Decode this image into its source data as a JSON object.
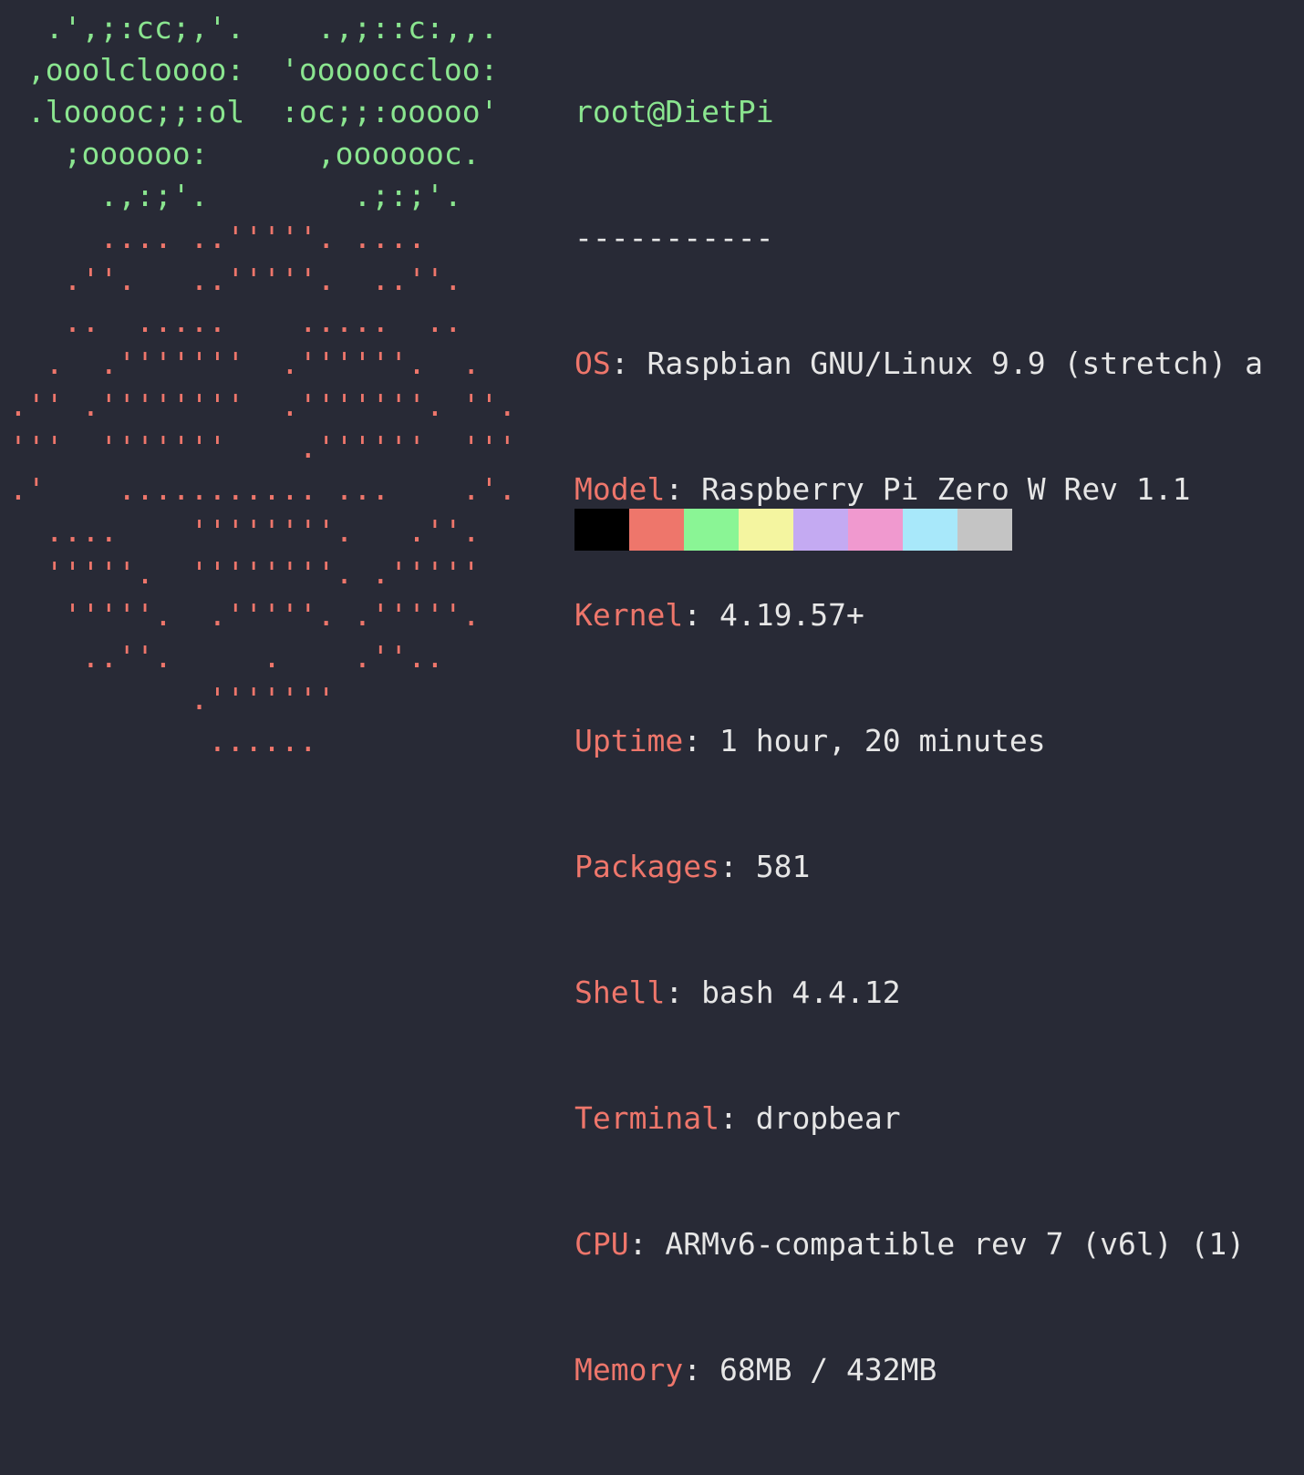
{
  "logo": {
    "green_lines": [
      "  .',;:cc;,'.    .,;::c:,,.",
      " ,ooolcloooo:  'oooooccloo:",
      " .looooc;;:ol  :oc;;:ooooo'",
      "   ;oooooo:      ,ooooooc.",
      "     .,:;'.        .;:;'."
    ],
    "red_lines": [
      "     .... ..'''''. ....",
      "   .''.   ..'''''.  ..''.",
      "   ..  .....    .....  ..",
      "  .  .'''''''  .''''''.  .",
      ".'' .''''''''  .'''''''. ''.",
      "'''  '''''''    .''''''  '''",
      ".'    ........... ...    .'.",
      "  ....    ''''''''.   .''.",
      "  '''''.  ''''''''. .'''''",
      "   '''''.  .'''''. .'''''.",
      "    ..''.     .    .''..",
      "          .'''''''",
      "           ......"
    ]
  },
  "info": {
    "user": "root",
    "at": "@",
    "host": "DietPi",
    "separator": "-----------",
    "fields": [
      {
        "key": "OS",
        "value": "Raspbian GNU/Linux 9.9 (stretch) a"
      },
      {
        "key": "Model",
        "value": "Raspberry Pi Zero W Rev 1.1"
      },
      {
        "key": "Kernel",
        "value": "4.19.57+"
      },
      {
        "key": "Uptime",
        "value": "1 hour, 20 minutes"
      },
      {
        "key": "Packages",
        "value": "581"
      },
      {
        "key": "Shell",
        "value": "bash 4.4.12"
      },
      {
        "key": "Terminal",
        "value": "dropbear"
      },
      {
        "key": "CPU",
        "value": "ARMv6-compatible rev 7 (v6l) (1)"
      },
      {
        "key": "Memory",
        "value": "68MB / 432MB"
      }
    ]
  },
  "palette": [
    "#000000",
    "#ee766b",
    "#8af595",
    "#f4f5a0",
    "#c4aaf2",
    "#f099cf",
    "#a8e8fa",
    "#c4c4c4"
  ]
}
